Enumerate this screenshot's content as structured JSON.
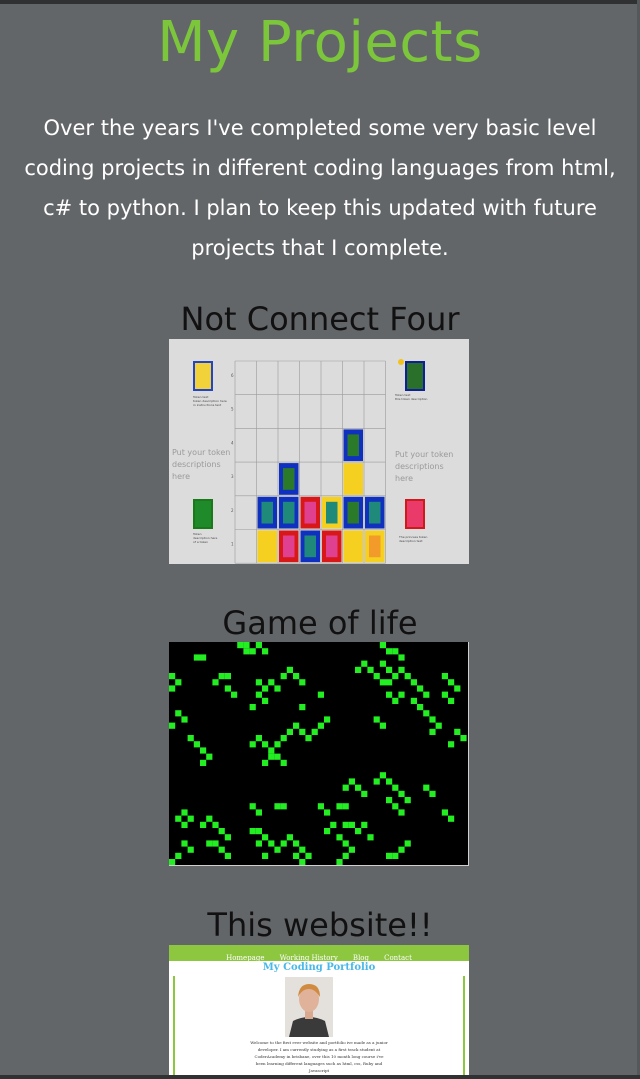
{
  "page": {
    "title": "My Projects",
    "intro": "Over the years I've completed some very basic level coding projects in different coding languages from html, c# to python. I plan to keep this updated with future projects that I complete."
  },
  "projects": [
    {
      "title": "Not Connect Four",
      "thumbnail": {
        "left_description": "Put your token descriptions here",
        "right_description": "Put your token descriptions here",
        "row_numbers": [
          "6",
          "5",
          "4",
          "3",
          "2",
          "1"
        ]
      }
    },
    {
      "title": "Game of life"
    },
    {
      "title": "This website!!",
      "thumbnail": {
        "nav": [
          "Homepage",
          "Working History",
          "Blog",
          "Contact"
        ],
        "heading": "My Coding Portfolio",
        "body": "Welcome to the first ever website and portfolio ive made as a junior developer. I am currently studying as a first track student at CoderAcademy in brisbane, over this 10 month long course i've been learning different languages such as html, css, Ruby and Javascript"
      }
    }
  ],
  "colors": {
    "background": "#636669",
    "title": "#7cc63b",
    "intro_text": "#ffffff",
    "project_title": "#111111",
    "life_cell": "#22ee22",
    "site_nav": "#8dc63f",
    "site_heading": "#49b8e8"
  }
}
